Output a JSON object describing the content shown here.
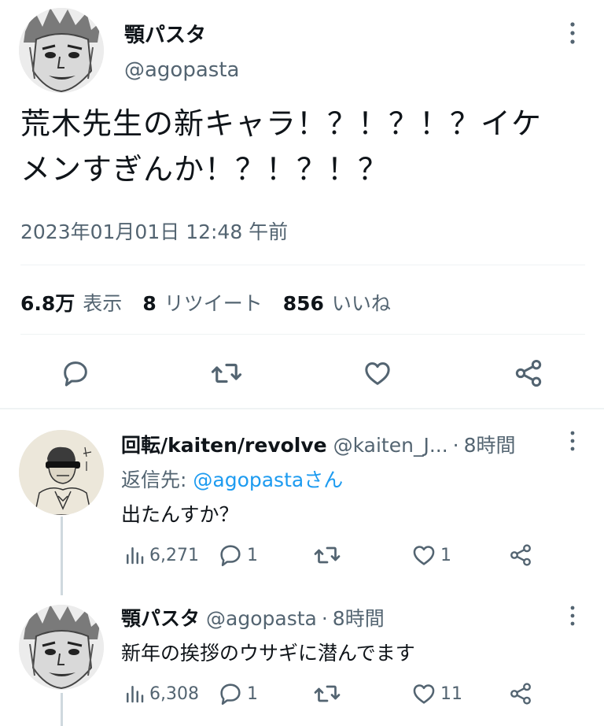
{
  "main_tweet": {
    "display_name": "顎パスタ",
    "handle": "@agopasta",
    "text_line1": "荒木先生の新キャラ！？！？！？イケ",
    "text_line2": "メンすぎんか！？！？！？",
    "timestamp": "2023年01月01日 12:48 午前",
    "stats": {
      "views_num": "6.8万",
      "views_label": "表示",
      "retweets_num": "8",
      "retweets_label": "リツイート",
      "likes_num": "856",
      "likes_label": "いいね"
    },
    "actions": [
      "reply-icon",
      "retweet-icon",
      "like-icon",
      "share-icon"
    ]
  },
  "replies": [
    {
      "display_name": "回転/kaiten/revolve",
      "handle": "@kaiten_J...",
      "dot": "·",
      "time": "8時間",
      "reply_to_prefix": "返信先: ",
      "reply_to_mention": "@agopastaさん",
      "text": "出たんすか？",
      "views": "6,271",
      "replies": "1",
      "retweets": "",
      "likes": "1"
    },
    {
      "display_name": "顎パスタ",
      "handle": "@agopasta",
      "dot": "·",
      "time": "8時間",
      "text": "新年の挨拶のウサギに潜んでます",
      "views": "6,308",
      "replies": "1",
      "retweets": "",
      "likes": "11"
    }
  ],
  "colors": {
    "text": "#0f1419",
    "secondary": "#536471",
    "link": "#1d9bf0",
    "divider": "#eff3f4"
  }
}
